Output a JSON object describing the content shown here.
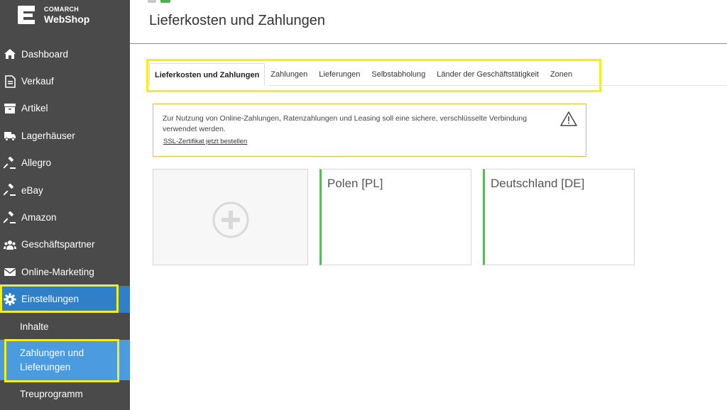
{
  "app": {
    "brand_small": "COMARCH",
    "brand_large": "WebShop"
  },
  "sidebar": {
    "items": [
      {
        "label": "Dashboard",
        "icon": "home-icon"
      },
      {
        "label": "Verkauf",
        "icon": "document-icon"
      },
      {
        "label": "Artikel",
        "icon": "box-icon"
      },
      {
        "label": "Lagerhäuser",
        "icon": "truck-icon"
      },
      {
        "label": "Allegro",
        "icon": "gavel-icon"
      },
      {
        "label": "eBay",
        "icon": "gavel-icon"
      },
      {
        "label": "Amazon",
        "icon": "gavel-icon"
      },
      {
        "label": "Geschäftspartner",
        "icon": "users-icon"
      },
      {
        "label": "Online-Marketing",
        "icon": "envelope-icon"
      },
      {
        "label": "Einstellungen",
        "icon": "gear-icon",
        "active": true
      }
    ],
    "subitems": [
      {
        "label": "Inhalte"
      },
      {
        "label": "Zahlungen und Lieferungen",
        "active": true
      },
      {
        "label": "Treuprogramm"
      }
    ]
  },
  "page": {
    "title": "Lieferkosten und Zahlungen"
  },
  "tabs": [
    {
      "label": "Lieferkosten und Zahlungen",
      "active": true
    },
    {
      "label": "Zahlungen"
    },
    {
      "label": "Lieferungen"
    },
    {
      "label": "Selbstabholung"
    },
    {
      "label": "Länder der Geschäftstätigkeit"
    },
    {
      "label": "Zonen"
    }
  ],
  "alert": {
    "text": "Zur Nutzung von Online-Zahlungen, Ratenzahlungen und Leasing soll eine sichere, verschlüsselte Verbindung verwendet werden.",
    "link": "SSL-Zertifikat jetzt bestellen",
    "icon": "warning-icon"
  },
  "cards": [
    {
      "label": "Polen [PL]"
    },
    {
      "label": "Deutschland [DE]"
    }
  ],
  "colors": {
    "sidebar_bg": "#4a4a4a",
    "active_nav": "#2f80c8",
    "active_subnav": "#4a9be0",
    "highlight": "#f5ee1d",
    "alert_border": "#e8b84d",
    "card_accent": "#5cb85c"
  }
}
